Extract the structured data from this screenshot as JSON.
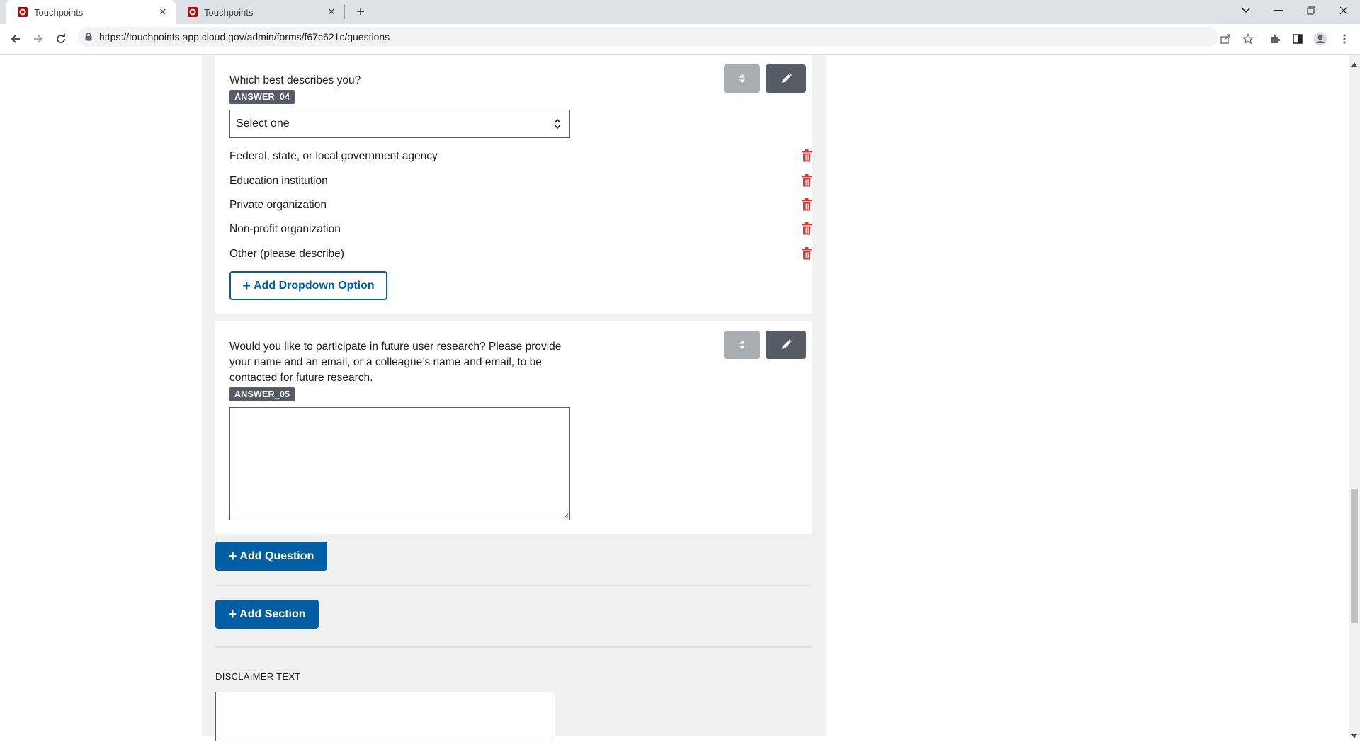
{
  "browser": {
    "tabs": [
      {
        "title": "Touchpoints",
        "active": true
      },
      {
        "title": "Touchpoints",
        "active": false
      }
    ],
    "url": "https://touchpoints.app.cloud.gov/admin/forms/f67c621c/questions"
  },
  "questions": [
    {
      "text": "Which best describes you?",
      "tag": "ANSWER_04",
      "select_value": "Select one",
      "options": [
        "Federal, state, or local government agency",
        "Education institution",
        "Private organization",
        "Non-profit organization",
        "Other (please describe)"
      ],
      "add_option_label": "Add Dropdown Option"
    },
    {
      "text_lines": [
        "Would you like to participate in future user research? Please provide",
        "your name and an email, or a colleague’s name and email, to be",
        "contacted for future research."
      ],
      "tag": "ANSWER_05"
    }
  ],
  "actions": {
    "add_question_label": "Add Question",
    "add_section_label": "Add Section"
  },
  "disclaimer": {
    "label": "DISCLAIMER TEXT"
  },
  "colors": {
    "primary": "#005ea2",
    "tag_bg": "#565c65",
    "danger": "#d83933",
    "page_bg": "#f0f0f0"
  },
  "icons": [
    "shield-favicon-icon",
    "close-icon",
    "plus-icon",
    "back-icon",
    "forward-icon",
    "reload-icon",
    "lock-icon",
    "share-icon",
    "star-icon",
    "extensions-icon",
    "sidepanel-icon",
    "profile-icon",
    "menu-icon",
    "move-icon",
    "pencil-icon",
    "trash-icon"
  ]
}
